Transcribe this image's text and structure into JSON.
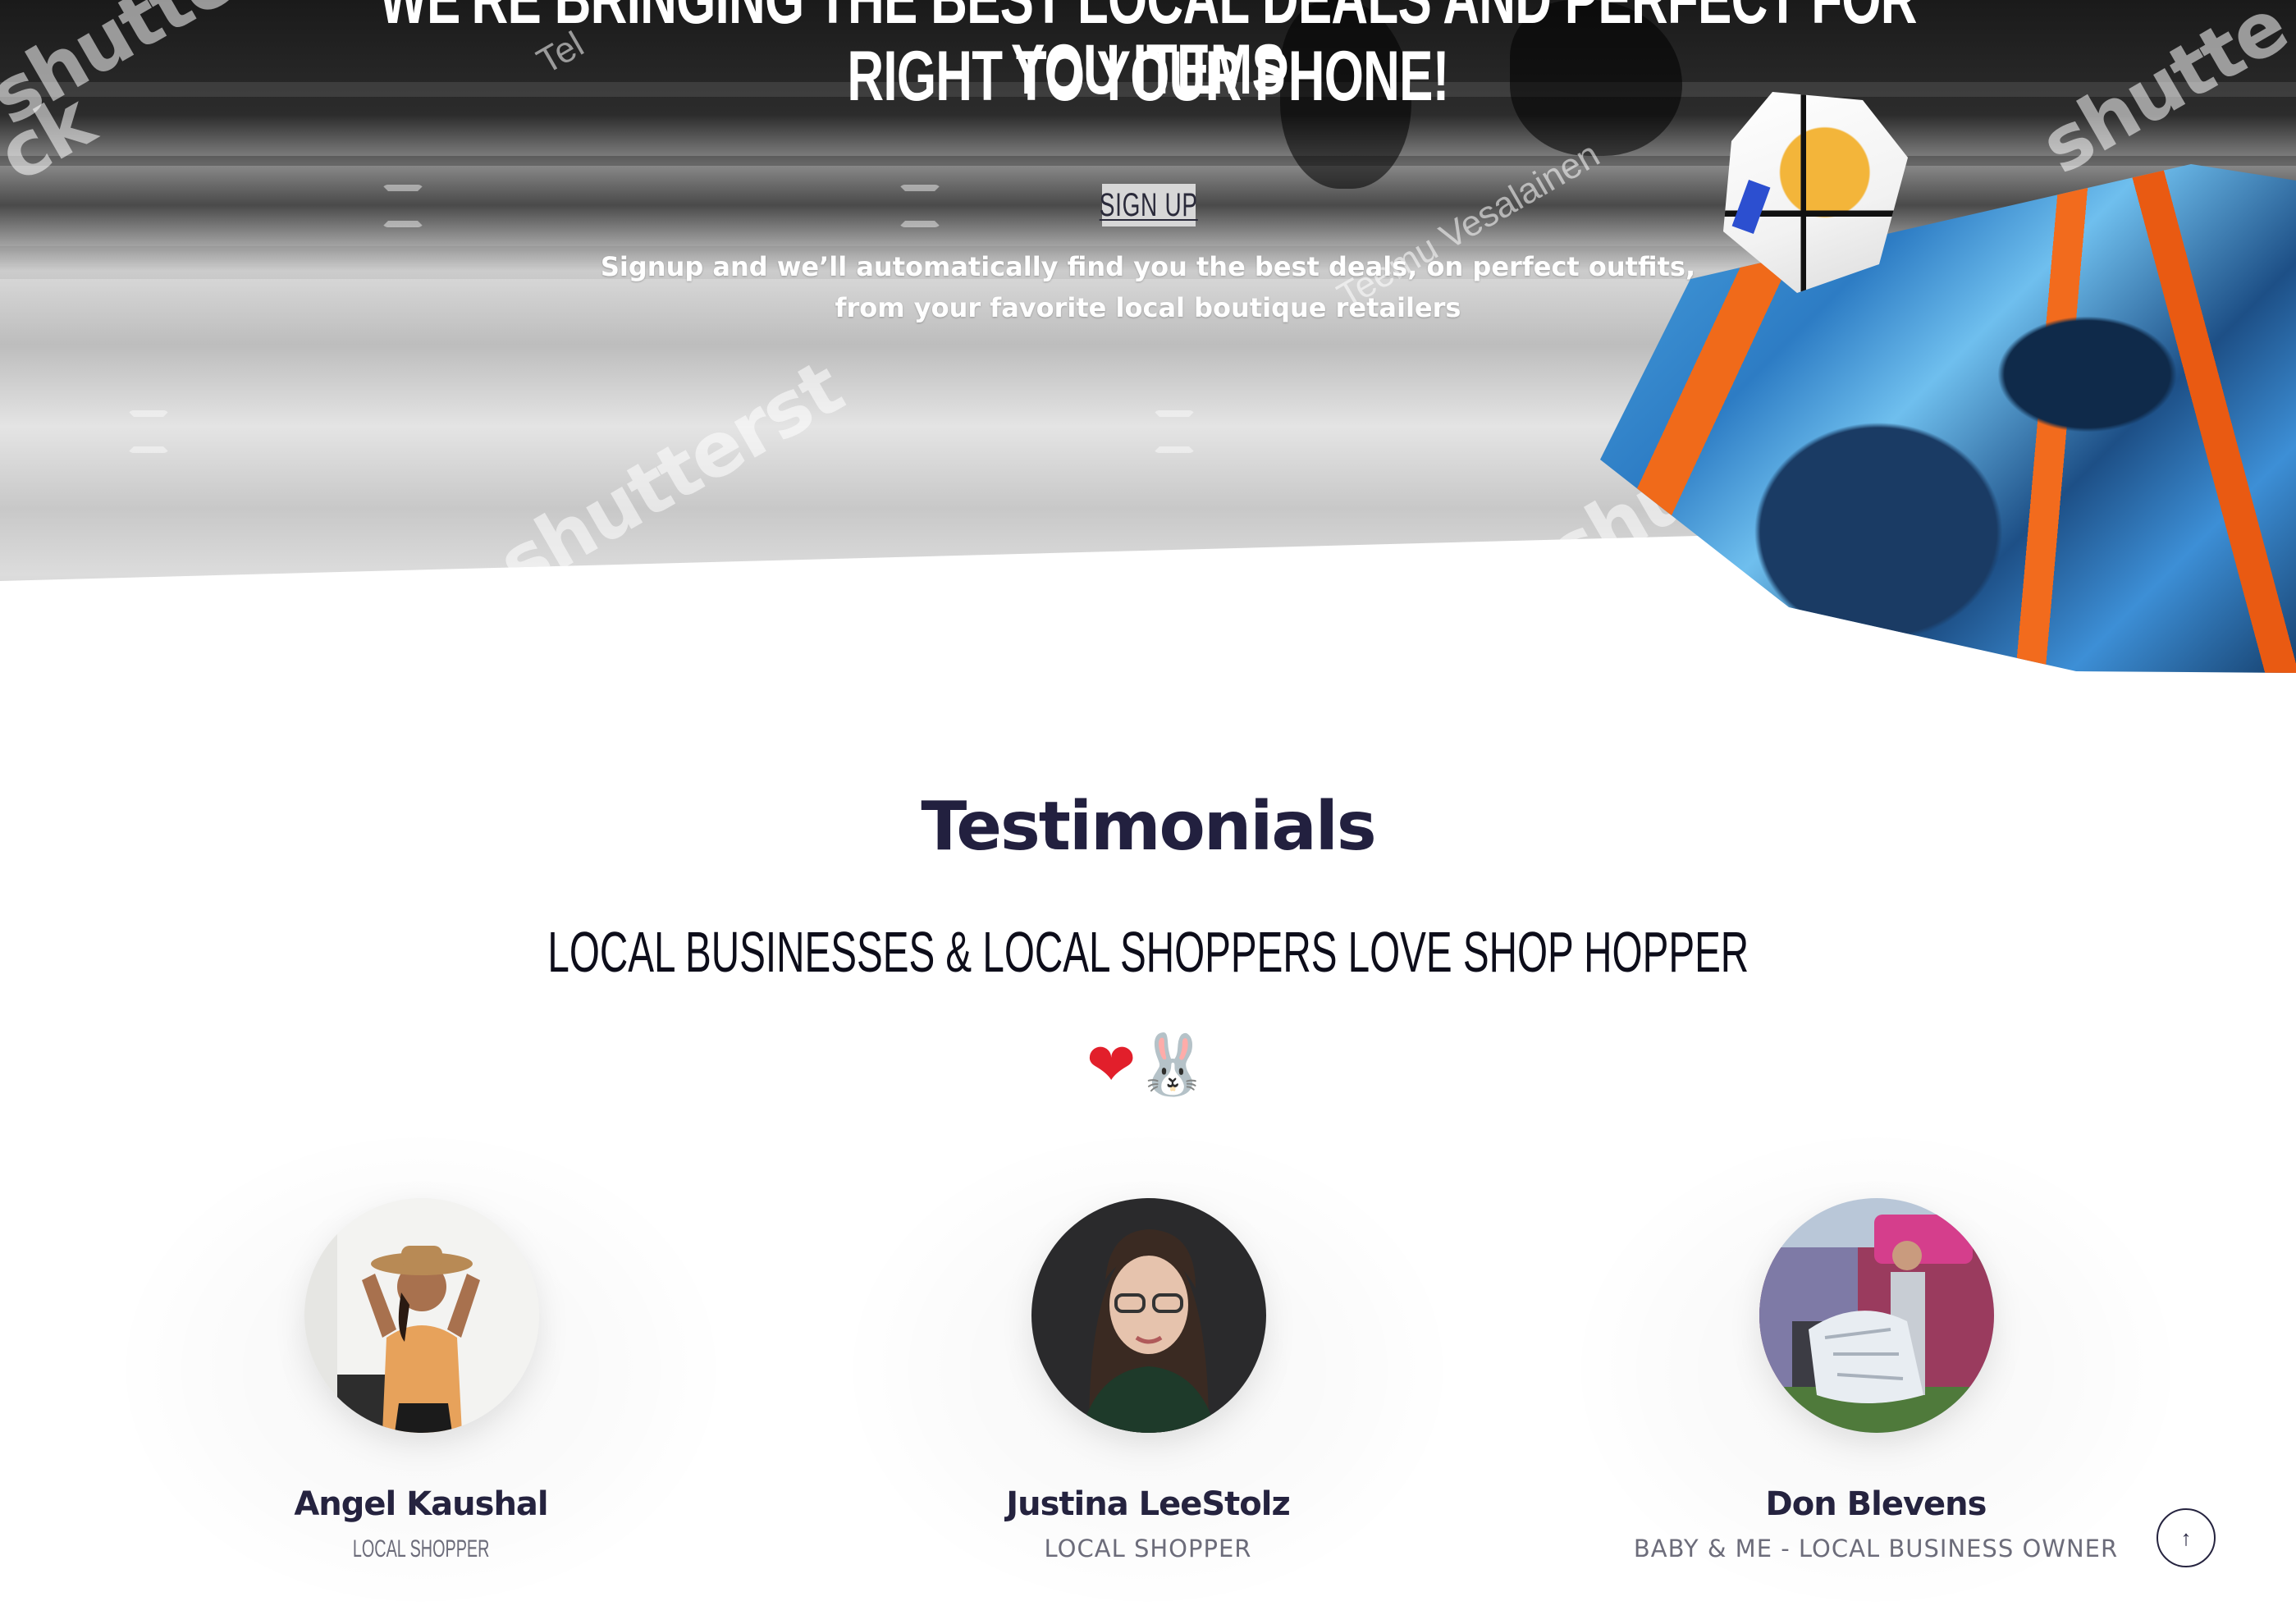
{
  "hero": {
    "title_line1": "WE'RE BRINGING THE BEST LOCAL DEALS AND PERFECT FOR YOU ITEMS",
    "title_line2": "RIGHT TO YOUR PHONE!",
    "signup_label": "SIGN UP",
    "subtitle_line1": "Signup and we’ll automatically find you the best deals, on perfect outfits,",
    "subtitle_line2": "from your favorite local boutique retailers",
    "watermarks": [
      "shutterstock",
      "shutterstock",
      "shutterstock",
      "shutterstock",
      "shutterst",
      "shutte",
      "ck"
    ],
    "watermark_credit": "Teemu Vesalainen",
    "watermark_credit_short": "Tel"
  },
  "testimonials": {
    "title": "Testimonials",
    "subtitle": "LOCAL BUSINESSES & LOCAL SHOPPERS LOVE SHOP HOPPER",
    "emoji": [
      "❤",
      "🐰"
    ],
    "people": [
      {
        "name": "Angel Kaushal",
        "role": "LOCAL SHOPPER",
        "avatar": "person-photo-angel"
      },
      {
        "name": "Justina LeeStolz",
        "role": "LOCAL SHOPPER",
        "avatar": "person-photo-justina"
      },
      {
        "name": "Don Blevens",
        "role": "BABY & ME - LOCAL BUSINESS OWNER",
        "avatar": "person-photo-don"
      }
    ]
  },
  "scroll_top": {
    "icon": "arrow-up-icon",
    "glyph": "↑"
  },
  "colors": {
    "heading": "#22203f",
    "role_text": "#6c6c7a",
    "heart": "#e21f2b",
    "painting_blue": "#2d7cc4",
    "painting_orange": "#f06a1a"
  }
}
